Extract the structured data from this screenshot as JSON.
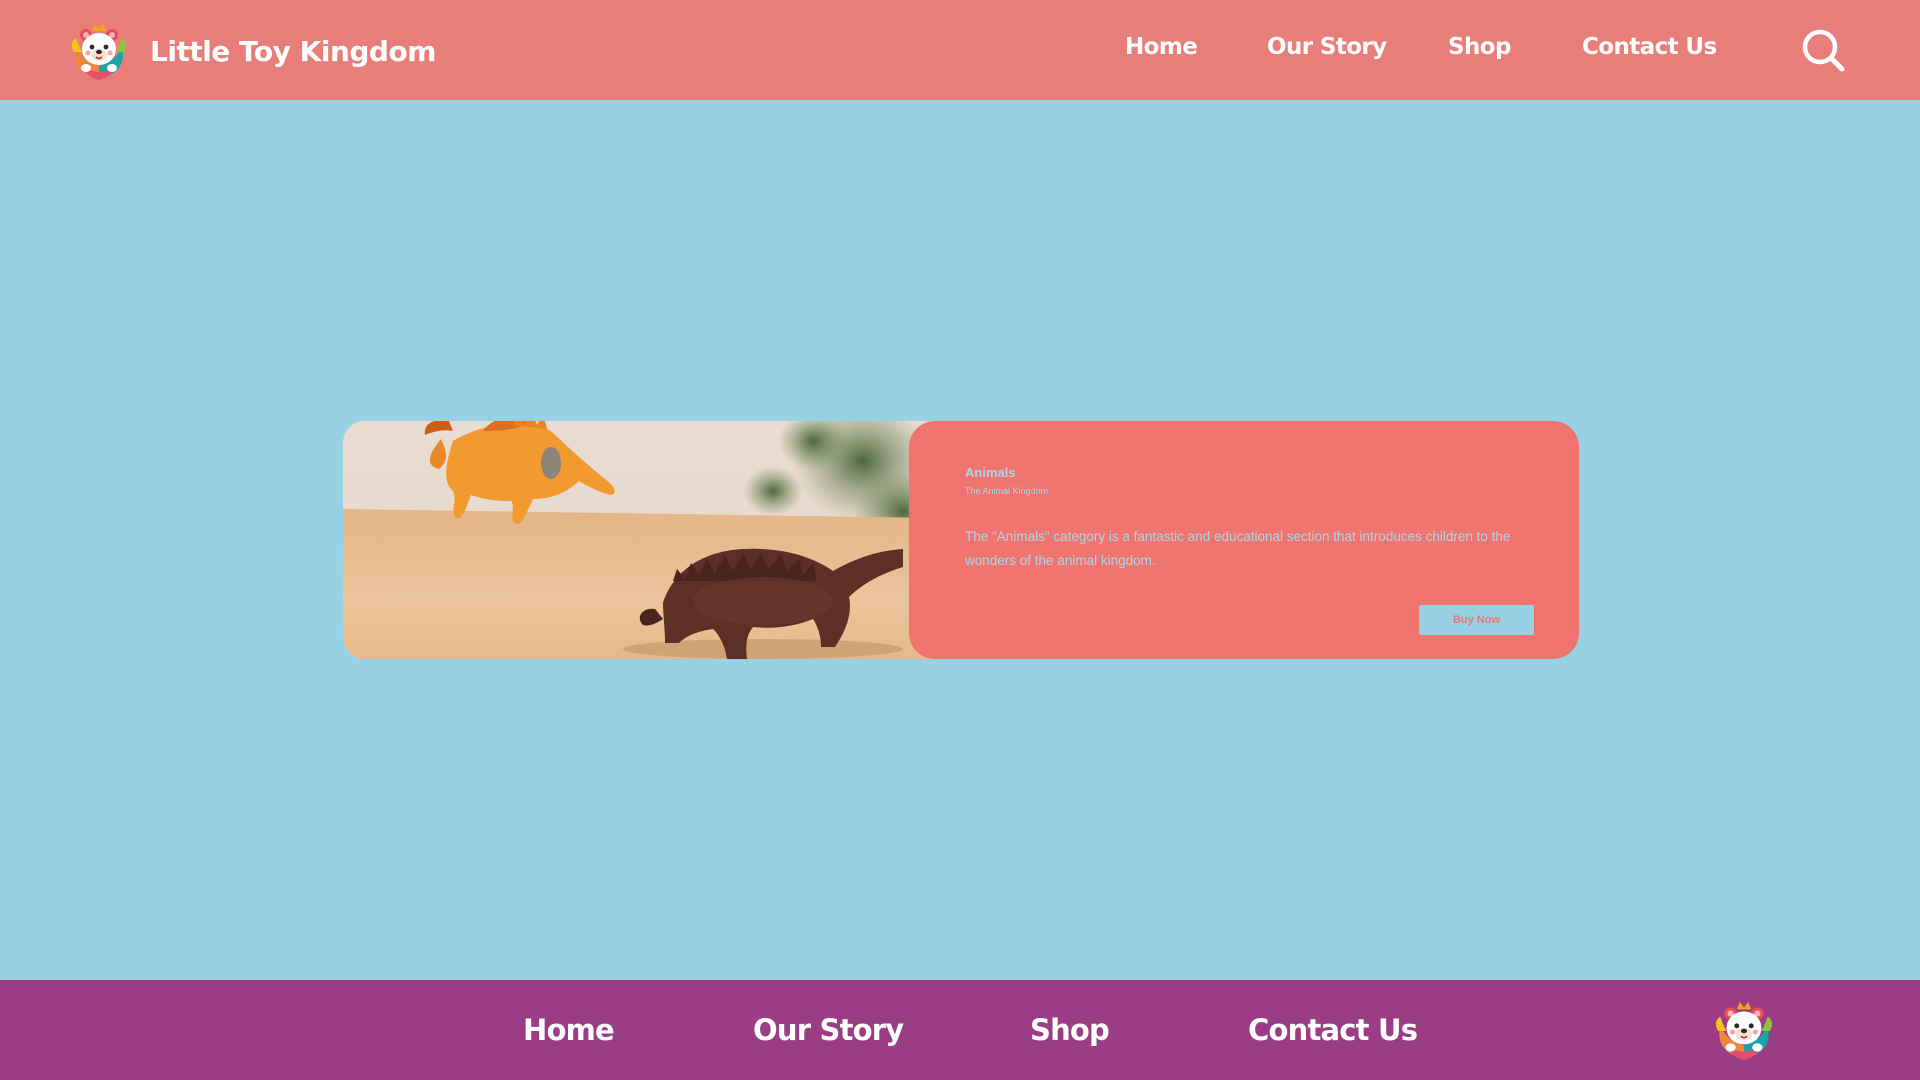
{
  "colors": {
    "header_bg": "#e77e7a",
    "page_bg": "#98d1e3",
    "card_panel_bg": "#ef7470",
    "card_text": "#a9d7e6",
    "button_bg": "#98d1e3",
    "button_text": "#e07a78",
    "footer_bg": "#9b3d85"
  },
  "header": {
    "brand_name": "Little Toy Kingdom",
    "logo_icon": "teddy-bear-logo-icon",
    "nav": [
      {
        "label": "Home"
      },
      {
        "label": "Our Story"
      },
      {
        "label": "Shop"
      },
      {
        "label": "Contact Us"
      }
    ],
    "search_icon": "search-icon"
  },
  "card": {
    "image_subject": "toy dinosaurs photo",
    "title": "Animals",
    "subtitle": "The Animal Kingdom",
    "description": "The \"Animals\" category is a fantastic and educational section that introduces children to the wonders of the animal kingdom.",
    "button_label": "Buy Now"
  },
  "footer": {
    "nav": [
      {
        "label": "Home"
      },
      {
        "label": "Our Story"
      },
      {
        "label": "Shop"
      },
      {
        "label": "Contact Us"
      }
    ],
    "logo_icon": "teddy-bear-logo-icon"
  }
}
